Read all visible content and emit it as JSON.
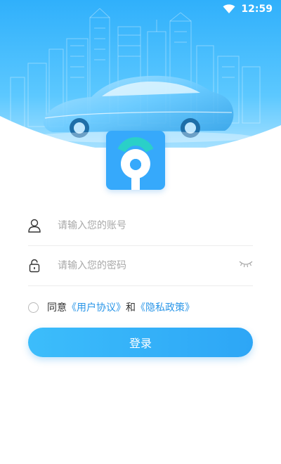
{
  "status_bar": {
    "time": "12:59",
    "wifi_icon": "wifi-icon"
  },
  "login": {
    "account": {
      "placeholder": "请输入您的账号",
      "icon": "user-icon"
    },
    "password": {
      "placeholder": "请输入您的密码",
      "icon": "lock-icon",
      "toggle_icon": "eye-closed-icon"
    },
    "agreement": {
      "prefix": "同意",
      "user_agreement": "《用户协议》",
      "and": "和",
      "privacy_policy": "《隐私政策》"
    },
    "submit_label": "登录"
  },
  "colors": {
    "primary": "#36a9fb",
    "link": "#2a96e8",
    "hero_top": "#33b2fb",
    "hero_bottom": "#8fd8ff"
  }
}
